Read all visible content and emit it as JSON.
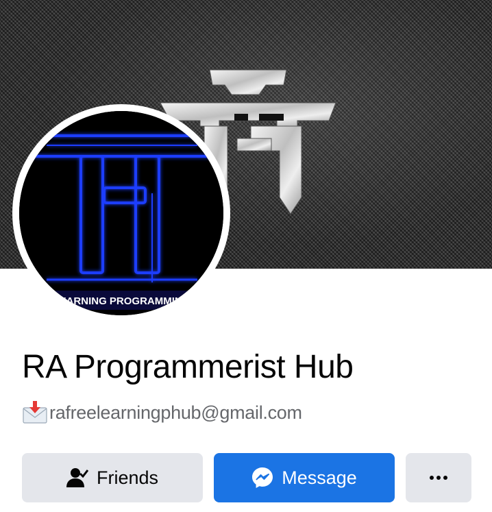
{
  "profile": {
    "name": "RA Programmerist Hub",
    "email": "rafreelearningphub@gmail.com",
    "avatar_caption": "EARNING PROGRAMMING"
  },
  "actions": {
    "friends_label": "Friends",
    "message_label": "Message"
  },
  "icons": {
    "friends": "person-check-icon",
    "message": "messenger-icon",
    "more": "more-dots-icon",
    "email": "incoming-envelope-icon"
  },
  "colors": {
    "primary_button": "#1b74e4",
    "secondary_button": "#e4e6eb",
    "avatar_glow": "#1a3cff"
  }
}
